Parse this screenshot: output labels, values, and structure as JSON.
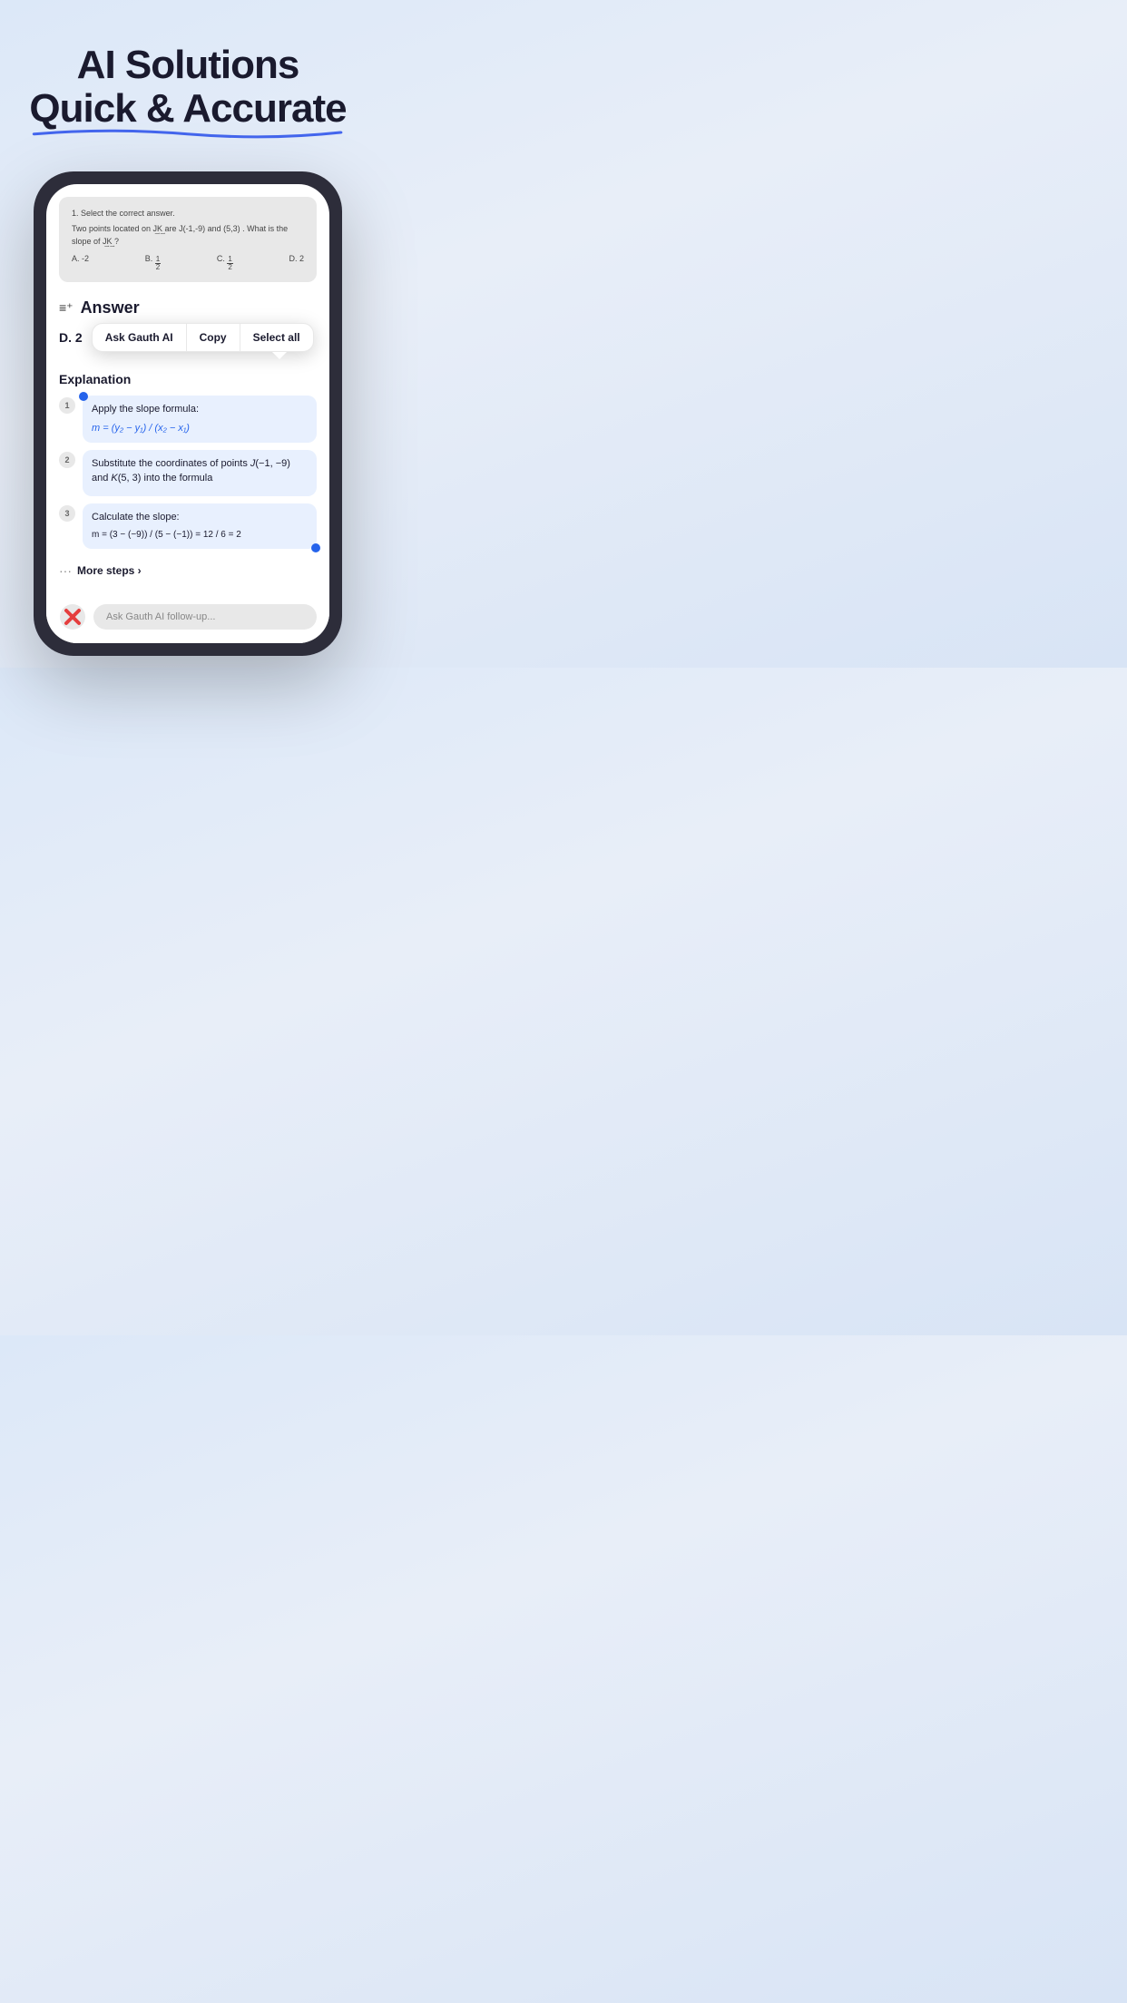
{
  "hero": {
    "line1": "AI Solutions",
    "line2": "Quick & Accurate"
  },
  "question": {
    "number": "1.",
    "instruction": "Select the correct answer.",
    "text": "Two points located on JK are  J(-1,-9)  and  (5,3) . What is the slope of  JK  ?",
    "options": [
      {
        "letter": "A.",
        "value": "-2"
      },
      {
        "letter": "B.",
        "numerator": "1",
        "denominator": "2",
        "fraction": true
      },
      {
        "letter": "C.",
        "numerator": "1",
        "denominator": "2",
        "fraction": true
      },
      {
        "letter": "D.",
        "value": "2"
      }
    ]
  },
  "answer": {
    "header_icon": "≡+",
    "header_label": "Answer",
    "value": "D. 2"
  },
  "context_menu": {
    "items": [
      {
        "id": "ask-gauth",
        "label": "Ask Gauth AI"
      },
      {
        "id": "copy",
        "label": "Copy"
      },
      {
        "id": "select-all",
        "label": "Select all"
      }
    ]
  },
  "explanation": {
    "title": "Explanation",
    "steps": [
      {
        "number": "1",
        "text": "Apply the slope formula:",
        "formula": "m = (y₂ − y₁) / (x₂ − x₁)"
      },
      {
        "number": "2",
        "text": "Substitute the coordinates of points J(−1, −9) and K(5, 3) into the formula",
        "formula": ""
      },
      {
        "number": "3",
        "text": "Calculate the slope:",
        "formula": "m = (3 − (−9)) / (5 − (−1)) = 12 / 6 = 2"
      }
    ],
    "more_steps": "More steps ›"
  },
  "bottom_bar": {
    "placeholder": "Ask Gauth AI follow-up..."
  }
}
